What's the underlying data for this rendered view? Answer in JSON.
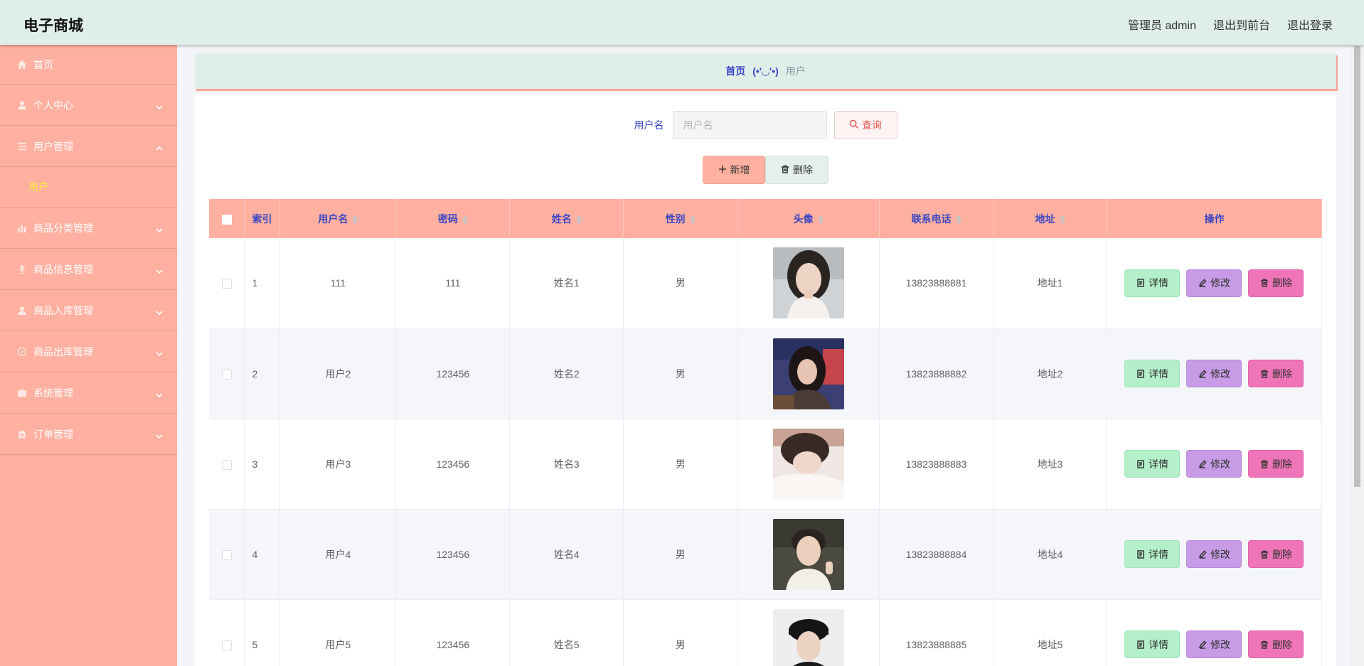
{
  "app": {
    "title": "电子商城"
  },
  "topbar": {
    "admin_label": "管理员 admin",
    "front_label": "退出到前台",
    "logout_label": "退出登录"
  },
  "sidebar": {
    "items": [
      {
        "label": "首页",
        "icon": "home-icon"
      },
      {
        "label": "个人中心",
        "icon": "user-icon"
      },
      {
        "label": "用户管理",
        "icon": "list-icon",
        "sub": "用户"
      },
      {
        "label": "商品分类管理",
        "icon": "bar-chart-icon"
      },
      {
        "label": "商品信息管理",
        "icon": "microphone-icon"
      },
      {
        "label": "商品入库管理",
        "icon": "user-icon"
      },
      {
        "label": "商品出库管理",
        "icon": "compass-icon"
      },
      {
        "label": "系统管理",
        "icon": "briefcase-icon"
      },
      {
        "label": "订单管理",
        "icon": "clipboard-icon"
      }
    ]
  },
  "breadcrumb": {
    "home": "首页",
    "sep": "(•'◡'•)",
    "current": "用户"
  },
  "search": {
    "label": "用户名",
    "placeholder": "用户名",
    "value": "",
    "button": "查询"
  },
  "actions": {
    "add": "新增",
    "delete": "删除"
  },
  "table": {
    "headers": [
      "索引",
      "用户名",
      "密码",
      "姓名",
      "性别",
      "头像",
      "联系电话",
      "地址",
      "操作"
    ],
    "rows": [
      {
        "index": "1",
        "username": "111",
        "password": "111",
        "name": "姓名1",
        "gender": "男",
        "phone": "13823888881",
        "address": "地址1"
      },
      {
        "index": "2",
        "username": "用户2",
        "password": "123456",
        "name": "姓名2",
        "gender": "男",
        "phone": "13823888882",
        "address": "地址2"
      },
      {
        "index": "3",
        "username": "用户3",
        "password": "123456",
        "name": "姓名3",
        "gender": "男",
        "phone": "13823888883",
        "address": "地址3"
      },
      {
        "index": "4",
        "username": "用户4",
        "password": "123456",
        "name": "姓名4",
        "gender": "男",
        "phone": "13823888884",
        "address": "地址4"
      },
      {
        "index": "5",
        "username": "用户5",
        "password": "123456",
        "name": "姓名5",
        "gender": "男",
        "phone": "13823888885",
        "address": "地址5"
      }
    ],
    "ops": {
      "detail": "详情",
      "edit": "修改",
      "remove": "删除"
    }
  },
  "colors": {
    "sidebar": "#ffb0a0",
    "header": "#dfeee8",
    "accent": "#3a46c4",
    "submenu_active": "#ffef3b"
  }
}
